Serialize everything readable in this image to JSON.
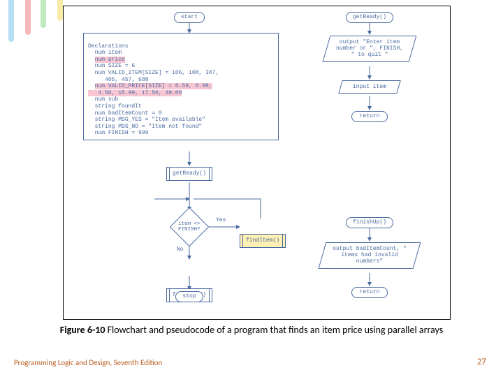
{
  "caption_bold": "Figure 6-10",
  "caption_rest": " Flowchart and pseudocode of a program that finds an item price using parallel arrays",
  "footer_left": "Programming Logic and Design, Seventh Edition",
  "footer_right": "27",
  "left": {
    "start": "start",
    "decl_header": "Declarations",
    "decl_l1": "num item",
    "decl_l2": "num price",
    "decl_l3": "num SIZE = 6",
    "decl_l4": "num VALID_ITEM[SIZE] = 106, 108, 307,",
    "decl_l4b": "   405, 457, 688",
    "decl_l5": "num VALID_PRICE[SIZE] = 0.59, 0.99,",
    "decl_l5b": "   4.50, 15.99, 17.50, 39.00",
    "decl_l6": "num sub",
    "decl_l7": "string foundIt",
    "decl_l8": "num badItemCount = 0",
    "decl_l9": "string MSG_YES = \"Item available\"",
    "decl_l10": "string MSG_NO = \"Item not found\"",
    "decl_l11": "num FINISH = 999",
    "getReadyCall": "getReady()",
    "decision": "item <> FINISH?",
    "yes": "Yes",
    "no": "No",
    "findItemCall": "findItem()",
    "finishUpCall": "finishUp()",
    "stop": "stop"
  },
  "rightTop": {
    "header": "getReady()",
    "output": "output \"Enter item\n number or \", FINISH,\n \" to quit \"",
    "input": "input item",
    "return": "return"
  },
  "rightBot": {
    "header": "finishUp()",
    "output": "output badItemCount,\n\" items had invalid\n numbers\"",
    "return": "return"
  }
}
